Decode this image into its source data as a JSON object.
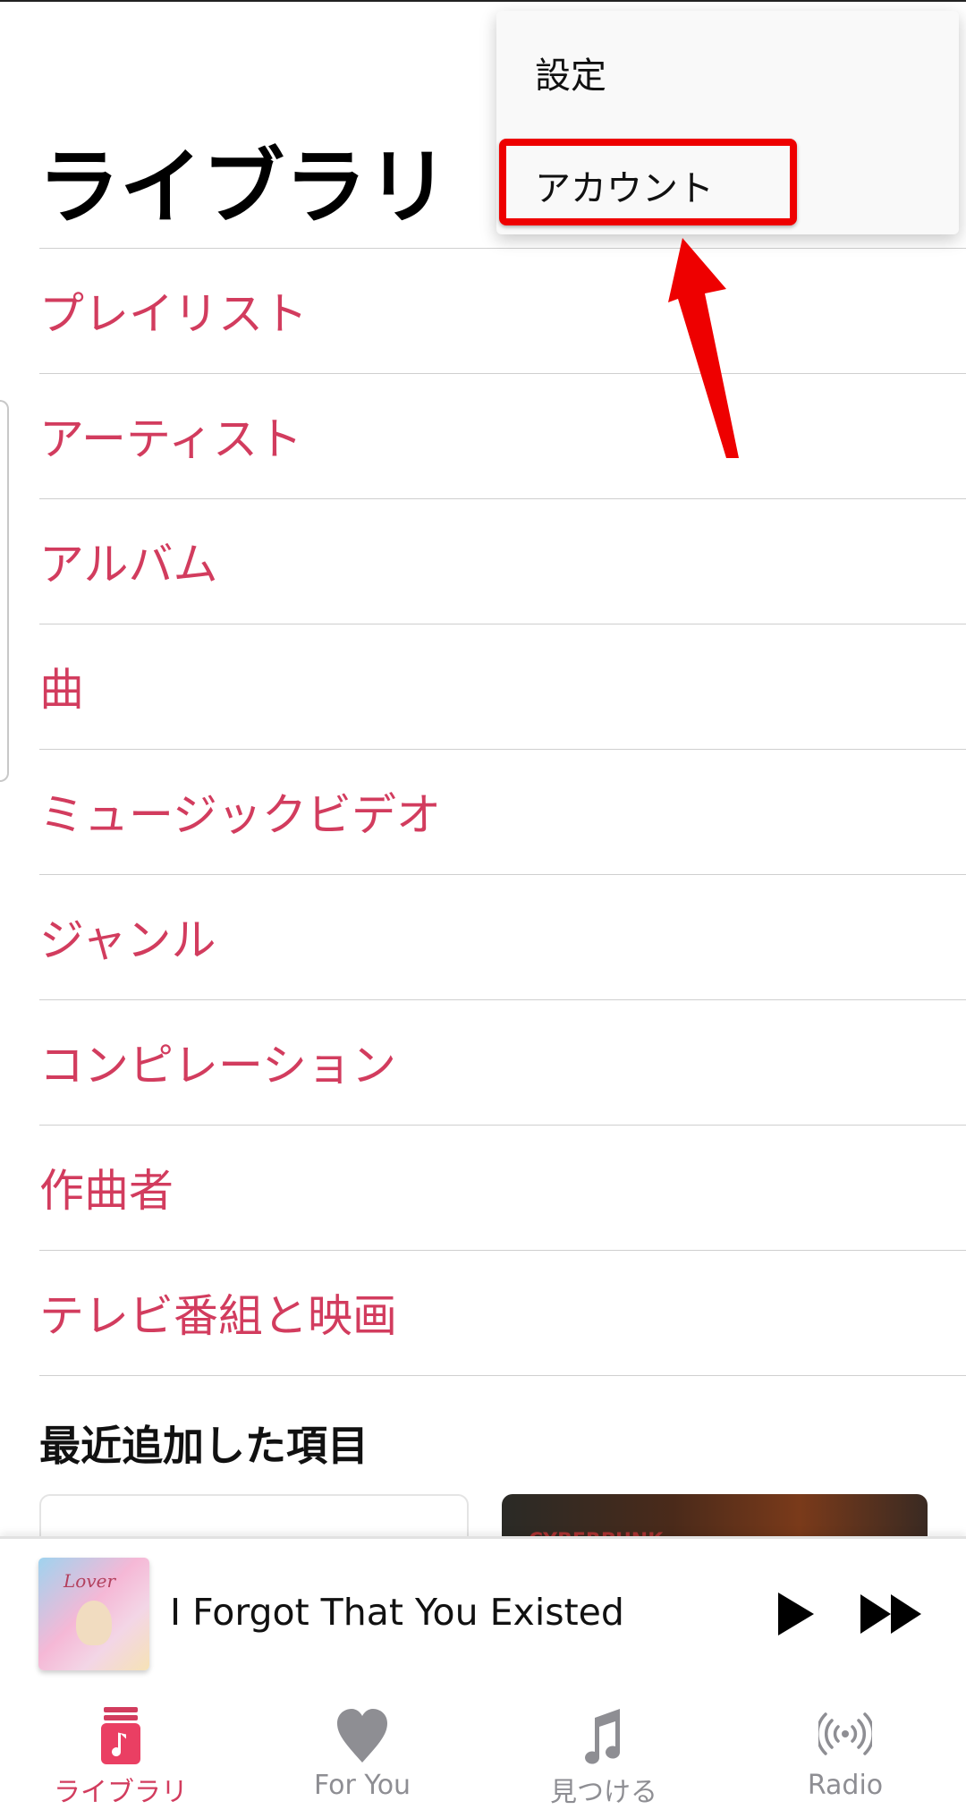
{
  "header": {
    "title": "ライブラリ"
  },
  "library_items": [
    {
      "label": "プレイリスト"
    },
    {
      "label": "アーティスト"
    },
    {
      "label": "アルバム"
    },
    {
      "label": "曲"
    },
    {
      "label": "ミュージックビデオ"
    },
    {
      "label": "ジャンル"
    },
    {
      "label": "コンピレーション"
    },
    {
      "label": "作曲者"
    },
    {
      "label": "テレビ番組と映画"
    }
  ],
  "recent": {
    "heading": "最近追加した項目",
    "right_card_text": "CYBERPUNK"
  },
  "now_playing": {
    "title": "I Forgot That You Existed",
    "art_text": "Lover",
    "play_icon": "play-icon",
    "next_icon": "fast-forward-icon"
  },
  "tabs": [
    {
      "label": "ライブラリ",
      "icon": "library-icon",
      "active": true
    },
    {
      "label": "For You",
      "icon": "heart-icon",
      "active": false
    },
    {
      "label": "見つける",
      "icon": "music-note-icon",
      "active": false
    },
    {
      "label": "Radio",
      "icon": "radio-icon",
      "active": false
    }
  ],
  "overflow_menu": {
    "items": [
      {
        "label": "設定"
      },
      {
        "label": "アカウント"
      }
    ],
    "highlighted": "アカウント"
  },
  "colors": {
    "accent": "#d23c5e",
    "annotation": "#ee0000",
    "inactive_tab": "#8e8e93"
  }
}
